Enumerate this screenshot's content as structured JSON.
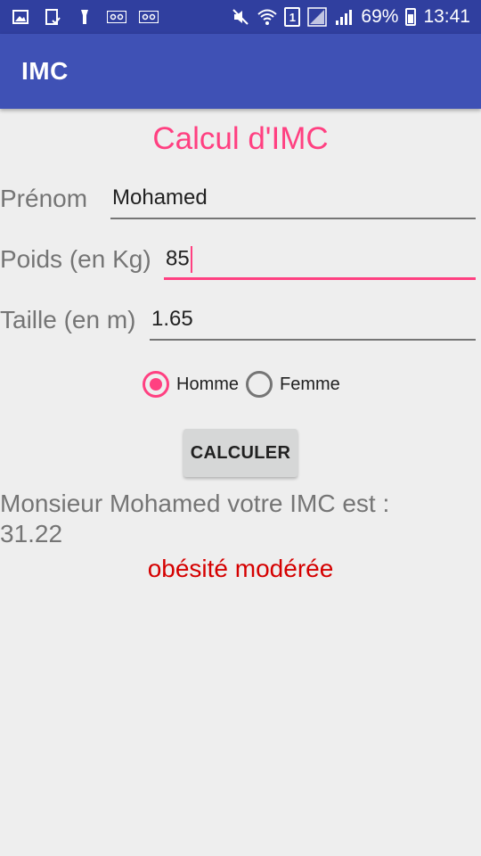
{
  "status_bar": {
    "icons_left": [
      "image-icon",
      "download-icon",
      "flashlight-icon",
      "voicemail-icon",
      "voicemail-icon"
    ],
    "sim_label": "1",
    "battery": "69%",
    "time": "13:41"
  },
  "app_bar": {
    "title": "IMC",
    "background": "#3f51b5"
  },
  "main": {
    "title": "Calcul d'IMC",
    "title_color": "#ff4081",
    "fields": {
      "prenom": {
        "label": "Prénom",
        "value": "Mohamed"
      },
      "poids": {
        "label": "Poids (en Kg)",
        "value": "85"
      },
      "taille": {
        "label": "Taille (en m)",
        "value": "1.65"
      }
    },
    "gender": {
      "options": [
        "Homme",
        "Femme"
      ],
      "selected": "Homme"
    },
    "button_label": "CALCULER",
    "result_line1": "Monsieur Mohamed votre IMC est :",
    "result_line2": "31.22",
    "category": "obésité modérée",
    "category_color": "#d50000"
  }
}
